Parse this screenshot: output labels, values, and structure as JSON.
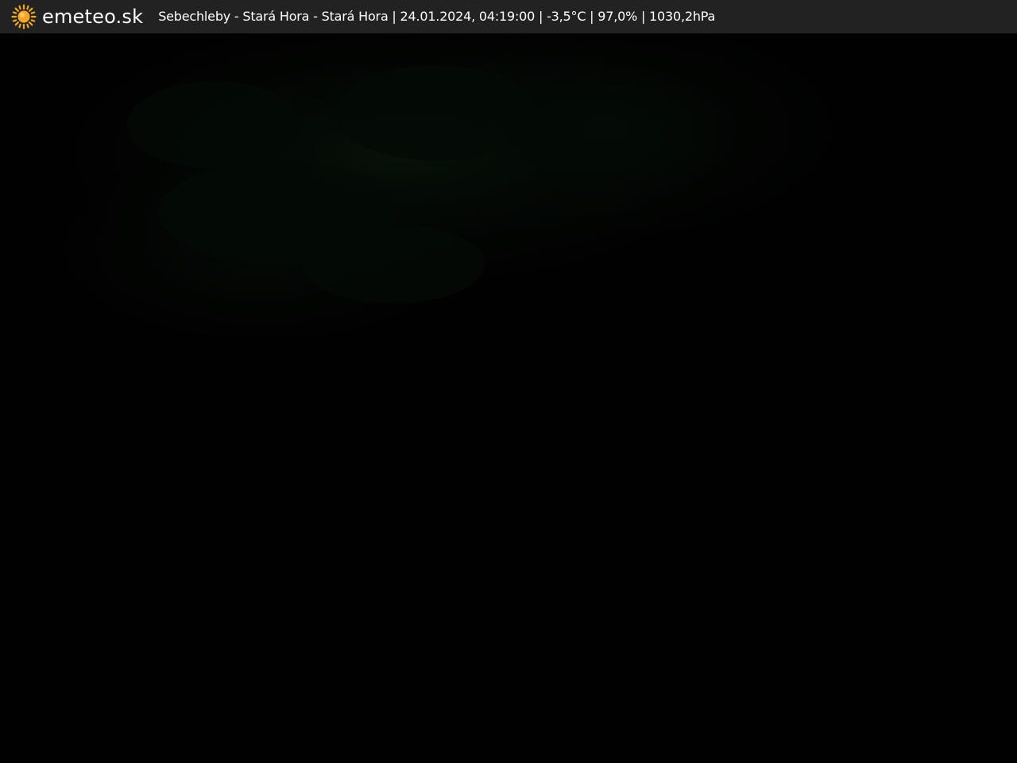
{
  "header": {
    "brand": "emeteo.sk",
    "caption": "Sebechleby - Stará Hora - Stará Hora | 24.01.2024, 04:19:00 | -3,5°C | 97,0% | 1030,2hPa",
    "logo_icon": "sun-icon",
    "sun_color": "#f5a623",
    "background_color": "#222222"
  },
  "webcam": {
    "background_color": "#010101"
  }
}
